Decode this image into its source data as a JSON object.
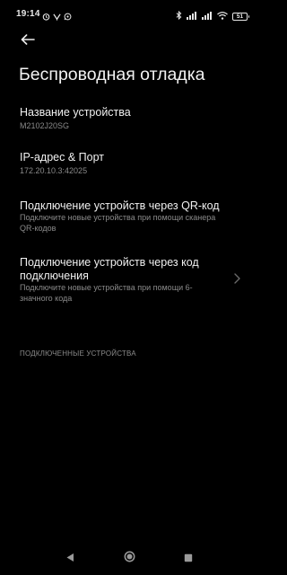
{
  "status_bar": {
    "time": "19:14",
    "battery_level": "51",
    "left_icons": [
      "clock-alarm-icon",
      "messenger-icon",
      "whatsapp-icon"
    ],
    "right_icons": [
      "bluetooth-icon",
      "signal-icon",
      "signal-icon",
      "wifi-icon",
      "battery-icon"
    ]
  },
  "header": {
    "back_icon": "arrow-left-icon",
    "title": "Беспроводная отладка"
  },
  "settings": [
    {
      "title": "Название устройства",
      "subtitle": "M2102J20SG"
    },
    {
      "title": "IP-адрес & Порт",
      "subtitle": "172.20.10.3:42025"
    },
    {
      "title": "Подключение устройств через QR-код",
      "subtitle": "Подключите новые устройства при помощи сканера QR-кодов"
    },
    {
      "title": "Подключение устройств через код подключения",
      "subtitle": "Подключите новые устройства при помощи 6-значного кода",
      "chevron_icon": "chevron-right-icon"
    }
  ],
  "paired_section": {
    "header": "ПОДКЛЮЧЕННЫЕ УСТРОЙСТВА"
  },
  "nav_bar": {
    "buttons": [
      "back-triangle-icon",
      "home-circle-icon",
      "recents-square-icon"
    ]
  },
  "colors": {
    "background": "#000000",
    "title_text": "#f0f0f0",
    "secondary_text": "#8a8a8a"
  }
}
